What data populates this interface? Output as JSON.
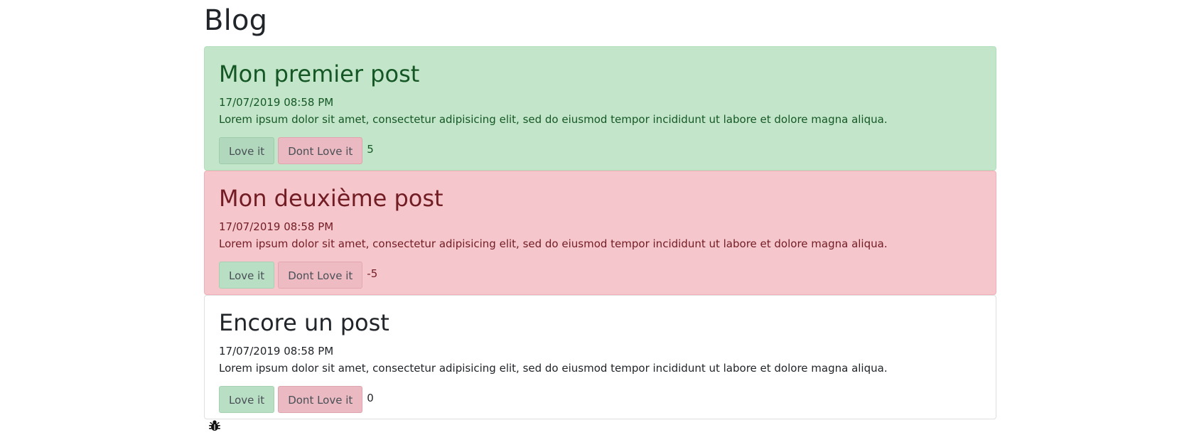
{
  "page": {
    "title": "Blog"
  },
  "posts": [
    {
      "title": "Mon premier post",
      "date": "17/07/2019 08:58 PM",
      "body": "Lorem ipsum dolor sit amet, consectetur adipisicing elit, sed do eiusmod tempor incididunt ut labore et dolore magna aliqua.",
      "love_label": "Love it",
      "dont_love_label": "Dont Love it",
      "score": "5",
      "state": "positive"
    },
    {
      "title": "Mon deuxième post",
      "date": "17/07/2019 08:58 PM",
      "body": "Lorem ipsum dolor sit amet, consectetur adipisicing elit, sed do eiusmod tempor incididunt ut labore et dolore magna aliqua.",
      "love_label": "Love it",
      "dont_love_label": "Dont Love it",
      "score": "-5",
      "state": "negative"
    },
    {
      "title": "Encore un post",
      "date": "17/07/2019 08:58 PM",
      "body": "Lorem ipsum dolor sit amet, consectetur adipisicing elit, sed do eiusmod tempor incididunt ut labore et dolore magna aliqua.",
      "love_label": "Love it",
      "dont_love_label": "Dont Love it",
      "score": "0",
      "state": "neutral"
    }
  ],
  "colors": {
    "positive_bg": "#c3e6cb",
    "positive_text": "#155724",
    "negative_bg": "#f5c6cb",
    "negative_text": "#721c24",
    "love_button": "#b8dec3",
    "dont_love_button": "#eab9c1"
  },
  "footer": {
    "icon": "bug-icon"
  }
}
